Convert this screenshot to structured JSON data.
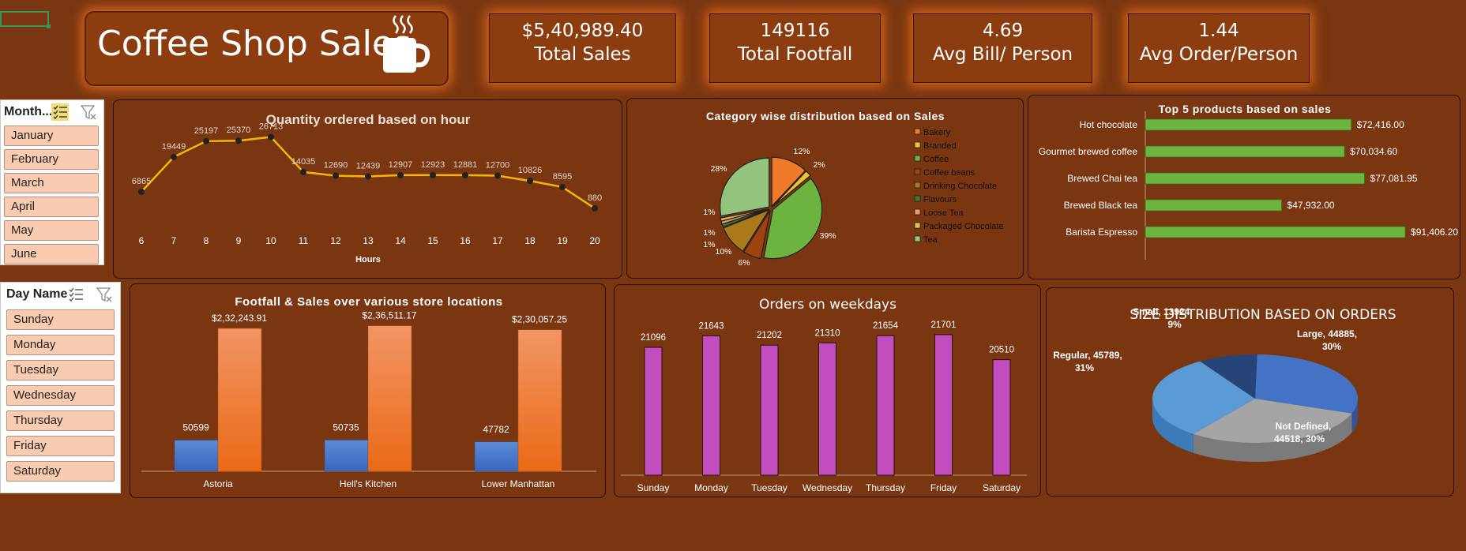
{
  "title": "Coffee Shop Sales",
  "kpis": [
    {
      "value": "$5,40,989.40",
      "label": "Total Sales"
    },
    {
      "value": "149116",
      "label": "Total Footfall"
    },
    {
      "value": "4.69",
      "label": "Avg Bill/ Person"
    },
    {
      "value": "1.44",
      "label": "Avg Order/Person"
    }
  ],
  "month_slicer": {
    "header": "Month...",
    "items": [
      "January",
      "February",
      "March",
      "April",
      "May",
      "June"
    ]
  },
  "day_slicer": {
    "header": "Day Name",
    "items": [
      "Sunday",
      "Monday",
      "Tuesday",
      "Wednesday",
      "Thursday",
      "Friday",
      "Saturday"
    ]
  },
  "colors": {
    "background": "#7a3610",
    "panel_glow": "#d9661c",
    "line": "#f2b705",
    "bar_green": "#6cb33f",
    "bar_blue": "#4472c4",
    "bar_orange": "#f07a2a",
    "bar_magenta": "#c24dbf"
  },
  "chart_data": [
    {
      "id": "hourly",
      "type": "line",
      "title": "Quantity ordered based on hour",
      "xlabel": "Hours",
      "ylabel": "",
      "x": [
        6,
        7,
        8,
        9,
        10,
        11,
        12,
        13,
        14,
        15,
        16,
        17,
        18,
        19,
        20
      ],
      "values": [
        6865,
        19449,
        25197,
        25370,
        26713,
        14035,
        12690,
        12439,
        12907,
        12923,
        12881,
        12700,
        10826,
        8595,
        880
      ]
    },
    {
      "id": "category",
      "type": "pie",
      "title": "Category wise distribution based on Sales",
      "legend_position": "right",
      "slices": [
        {
          "label": "Bakery",
          "pct_label": "12%",
          "value": 12,
          "color": "#f07a2a"
        },
        {
          "label": "Branded",
          "pct_label": "2%",
          "value": 2,
          "color": "#f2c12e"
        },
        {
          "label": "Coffee",
          "pct_label": "39%",
          "value": 39,
          "color": "#6cb33f"
        },
        {
          "label": "Coffee beans",
          "pct_label": "6%",
          "value": 6,
          "color": "#a0420f"
        },
        {
          "label": "Drinking Chocolate",
          "pct_label": "10%",
          "value": 10,
          "color": "#a9791a"
        },
        {
          "label": "Flavours",
          "pct_label": "1%",
          "value": 1,
          "color": "#3f7a2a"
        },
        {
          "label": "Loose Tea",
          "pct_label": "1%",
          "value": 1,
          "color": "#f49a6a"
        },
        {
          "label": "Packaged Chocolate",
          "pct_label": "1%",
          "value": 1,
          "color": "#e0c24a"
        },
        {
          "label": "Tea",
          "pct_label": "28%",
          "value": 28,
          "color": "#93c47d"
        }
      ]
    },
    {
      "id": "top5",
      "type": "bar",
      "title": "Top 5 products based on sales",
      "orientation": "horizontal",
      "categories": [
        "Hot chocolate",
        "Gourmet brewed coffee",
        "Brewed Chai tea",
        "Brewed Black tea",
        "Barista Espresso"
      ],
      "values": [
        72416.0,
        70034.6,
        77081.95,
        47932.0,
        91406.2
      ],
      "labels": [
        "$72,416.00",
        "$70,034.60",
        "$77,081.95",
        "$47,932.00",
        "$91,406.20"
      ]
    },
    {
      "id": "locations",
      "type": "bar",
      "title": "Footfall & Sales over various store locations",
      "categories": [
        "Astoria",
        "Hell's Kitchen",
        "Lower Manhattan"
      ],
      "series": [
        {
          "values": [
            50599,
            50735,
            47782
          ],
          "labels": [
            "50599",
            "50735",
            "47782"
          ],
          "color": "#4472c4"
        },
        {
          "values": [
            232243.91,
            236511.17,
            230057.25
          ],
          "labels": [
            "$2,32,243.91",
            "$2,36,511.17",
            "$2,30,057.25"
          ],
          "color": "#f07a2a"
        }
      ]
    },
    {
      "id": "weekdays",
      "type": "bar",
      "title": "Orders on weekdays",
      "categories": [
        "Sunday",
        "Monday",
        "Tuesday",
        "Wednesday",
        "Thursday",
        "Friday",
        "Saturday"
      ],
      "values": [
        21096,
        21643,
        21202,
        21310,
        21654,
        21701,
        20510
      ]
    },
    {
      "id": "sizes",
      "type": "pie",
      "title": "SIZE DISTRIBUTION BASED ON ORDERS",
      "slices": [
        {
          "label": "Large, 44885,",
          "pct_label": "30%",
          "value": 44885,
          "color": "#4472c4"
        },
        {
          "label": "Not Defined,",
          "pct_label": "44518, 30%",
          "value": 44518,
          "color": "#a5a5a5"
        },
        {
          "label": "Regular, 45789,",
          "pct_label": "31%",
          "value": 45789,
          "color": "#5b9bd5"
        },
        {
          "label": "Small, 13924,",
          "pct_label": "9%",
          "value": 13924,
          "color": "#264478"
        }
      ]
    }
  ]
}
